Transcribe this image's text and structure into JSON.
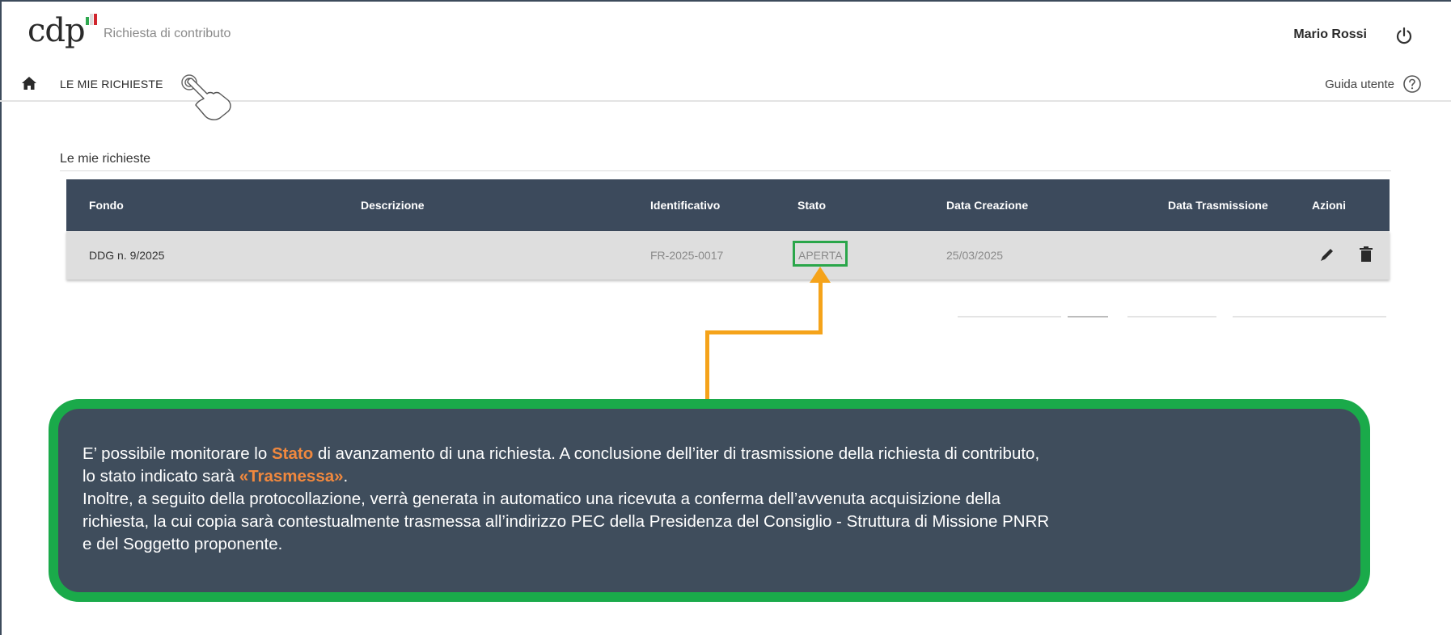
{
  "header": {
    "logo_text": "cdp",
    "app_subtitle": "Richiesta di contributo",
    "user_name": "Mario Rossi"
  },
  "nav": {
    "my_requests": "LE MIE RICHIESTE",
    "user_guide": "Guida utente"
  },
  "section": {
    "title": "Le mie richieste"
  },
  "table": {
    "columns": [
      "Fondo",
      "Descrizione",
      "Identificativo",
      "Stato",
      "Data Creazione",
      "Data Trasmissione",
      "Azioni"
    ],
    "rows": [
      {
        "fondo": "DDG n. 9/2025",
        "descrizione": "",
        "identificativo": "FR-2025-0017",
        "stato": "APERTA",
        "data_creazione": "25/03/2025",
        "data_trasmissione": ""
      }
    ]
  },
  "callout": {
    "l1a": "E’ possibile monitorare lo ",
    "l1b": "Stato",
    "l1c": " di avanzamento di una richiesta. A conclusione dell’iter di trasmissione della richiesta di contributo,",
    "l2a": "lo stato indicato sarà ",
    "l2b": "«Trasmessa»",
    "l2c": ".",
    "l3": "Inoltre, a seguito della protocollazione, verrà generata in automatico una ricevuta a conferma dell’avvenuta acquisizione della",
    "l4": "richiesta, la cui copia sarà contestualmente trasmessa all’indirizzo PEC della Presidenza del Consiglio - Struttura di Missione PNRR",
    "l5": "e del Soggetto proponente."
  },
  "colors": {
    "header_bar": "#3c4a5c",
    "callout_bg": "#3f4d5c",
    "callout_border": "#1aaa4a",
    "connector": "#f5a31a",
    "accent_text": "#f0883e",
    "highlight_box": "#2aa64a"
  },
  "icons": [
    "home-icon",
    "power-icon",
    "help-icon",
    "hand-pointer-icon",
    "edit-icon",
    "trash-icon"
  ]
}
